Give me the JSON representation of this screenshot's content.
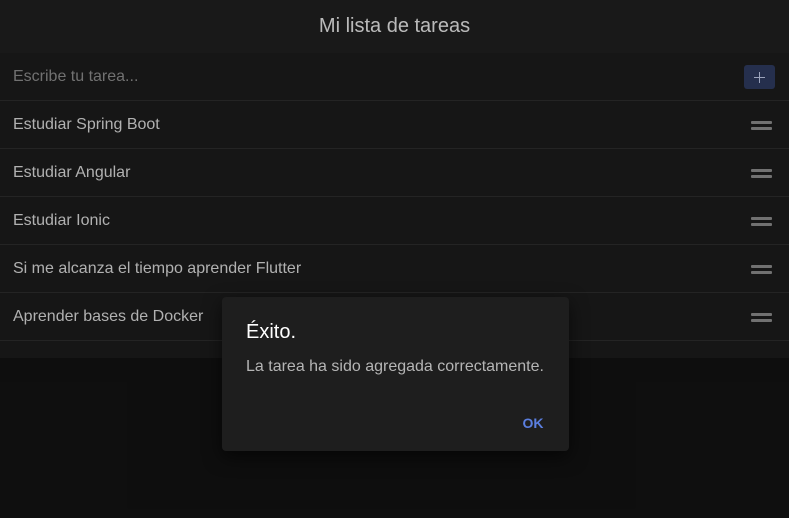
{
  "header": {
    "title": "Mi lista de tareas"
  },
  "input": {
    "placeholder": "Escribe tu tarea...",
    "value": ""
  },
  "add_button": {
    "icon": "plus-icon"
  },
  "tasks": [
    {
      "label": "Estudiar Spring Boot",
      "icon": "reorder-icon"
    },
    {
      "label": "Estudiar Angular",
      "icon": "reorder-icon"
    },
    {
      "label": "Estudiar Ionic",
      "icon": "reorder-icon"
    },
    {
      "label": "Si me alcanza el tiempo aprender Flutter",
      "icon": "reorder-icon"
    },
    {
      "label": "Aprender bases de Docker",
      "icon": "reorder-icon"
    }
  ],
  "alert": {
    "title": "Éxito.",
    "message": "La tarea ha sido agregada correctamente.",
    "ok_label": "OK"
  },
  "colors": {
    "background": "#121212",
    "header": "#1f1f1f",
    "accent": "#5b7fe0",
    "add_button": "#2e3a5e"
  }
}
